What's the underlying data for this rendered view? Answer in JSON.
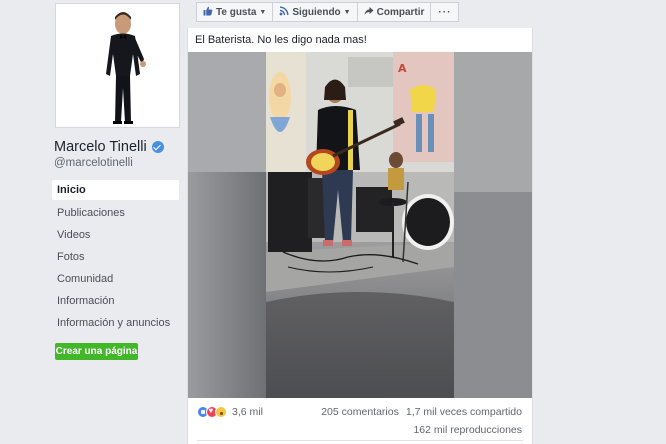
{
  "page": {
    "name": "Marcelo Tinelli",
    "handle": "@marcelotinelli"
  },
  "sidebar": {
    "items": [
      {
        "label": "Inicio",
        "active": true
      },
      {
        "label": "Publicaciones"
      },
      {
        "label": "Videos"
      },
      {
        "label": "Fotos"
      },
      {
        "label": "Comunidad"
      },
      {
        "label": "Información"
      },
      {
        "label": "Información y anuncios"
      }
    ],
    "create_page_label": "Crear una página"
  },
  "toolbar": {
    "like_label": "Te gusta",
    "following_label": "Siguiendo",
    "share_label": "Compartir",
    "more_label": "···"
  },
  "post": {
    "text": "El Baterista. No les digo nada mas!",
    "reactions_count": "3,6 mil",
    "comments": "205 comentarios",
    "shares": "1,7 mil veces compartido",
    "views": "162 mil reproducciones"
  },
  "colors": {
    "verified": "#4a90e2",
    "create_button": "#42b72a",
    "like": "#4a86f3",
    "love": "#f0435b",
    "wow": "#f7c544"
  },
  "icons": [
    "verified-badge-icon",
    "thumbs-up-icon",
    "rss-icon",
    "share-arrow-icon",
    "volume-icon",
    "like-reaction-icon",
    "love-reaction-icon",
    "wow-reaction-icon"
  ]
}
